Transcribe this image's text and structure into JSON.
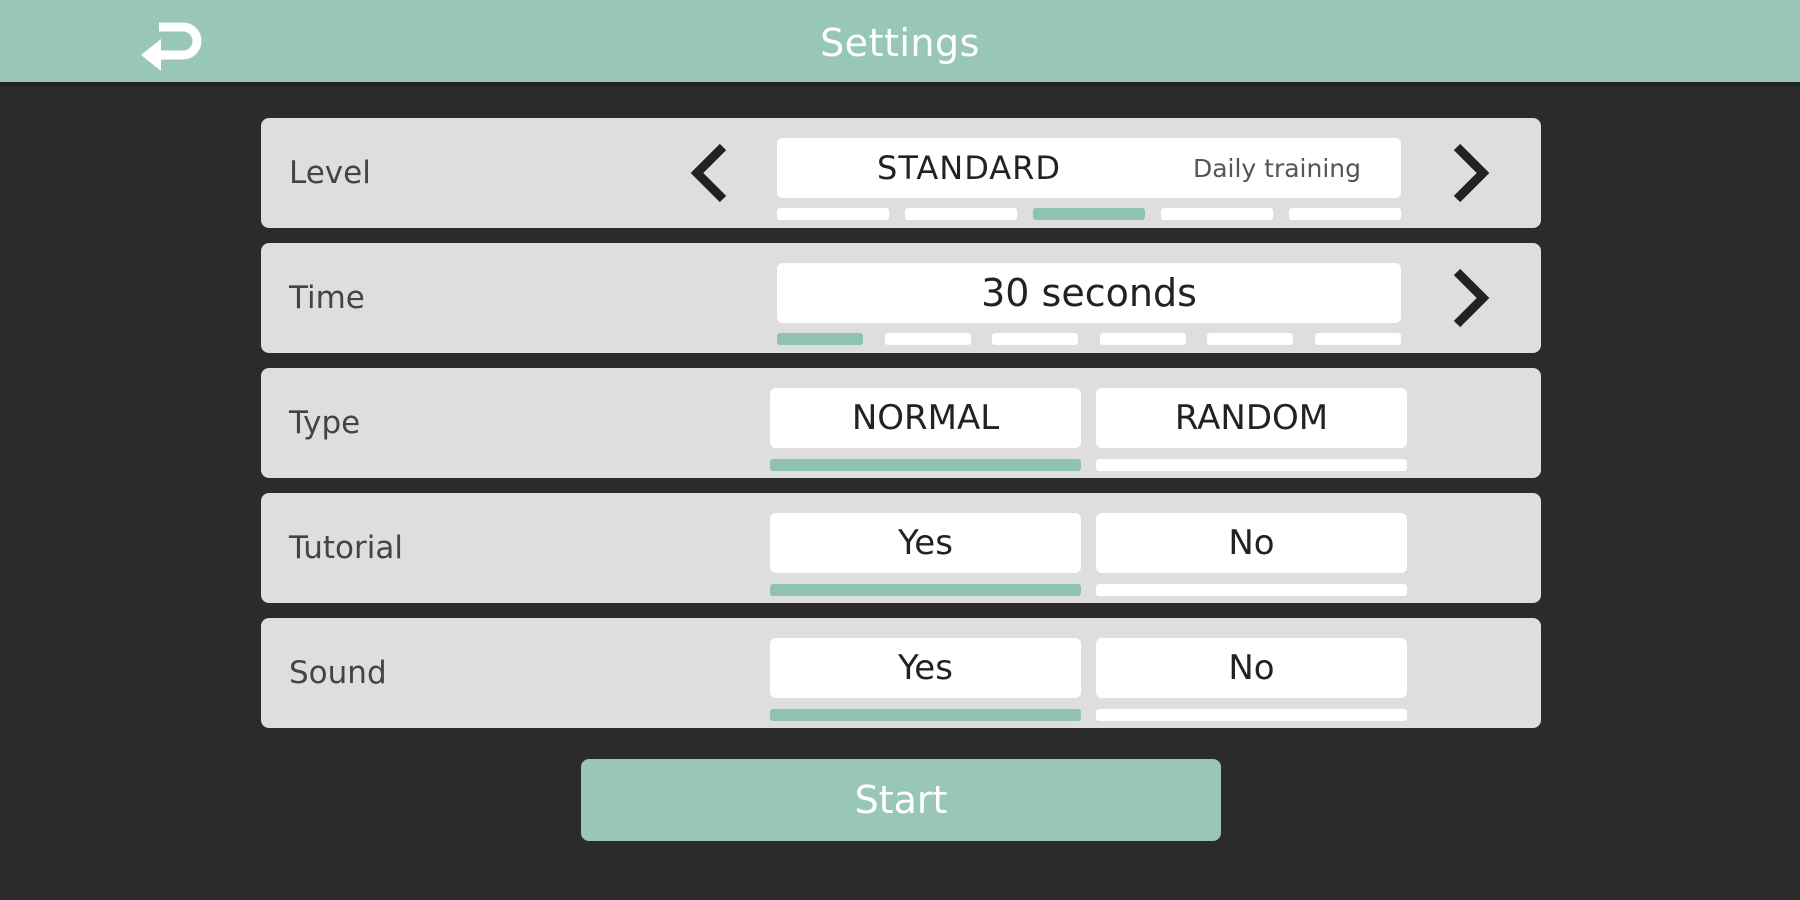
{
  "header": {
    "title": "Settings",
    "back_icon": "return-arrow-icon"
  },
  "level": {
    "label": "Level",
    "value": "STANDARD",
    "description": "Daily training",
    "selected_index": 2,
    "total_options": 5
  },
  "time": {
    "label": "Time",
    "value": "30 seconds",
    "selected_index": 0,
    "total_options": 6
  },
  "type": {
    "label": "Type",
    "options": [
      "NORMAL",
      "RANDOM"
    ],
    "selected": "NORMAL"
  },
  "tutorial": {
    "label": "Tutorial",
    "options": [
      "Yes",
      "No"
    ],
    "selected": "Yes"
  },
  "sound": {
    "label": "Sound",
    "options": [
      "Yes",
      "No"
    ],
    "selected": "Yes"
  },
  "start_label": "Start",
  "colors": {
    "accent": "#98c6b9",
    "background": "#2b2b2b",
    "panel": "#dedede"
  }
}
